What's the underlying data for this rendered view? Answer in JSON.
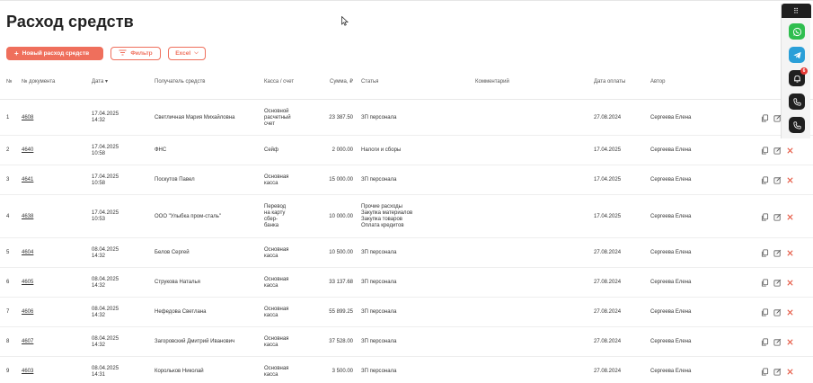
{
  "page": {
    "title": "Расход средств"
  },
  "toolbar": {
    "new_label": "Новый расход средств",
    "filter_label": "Фильтр",
    "excel_label": "Excel"
  },
  "table": {
    "columns": {
      "num": "№",
      "doc": "№ документа",
      "date": "Дата",
      "recipient": "Получатель средств",
      "kassa": "Касса / счет",
      "sum": "Сумма, ₽",
      "article": "Статья",
      "comment": "Комментарий",
      "paydate": "Дата оплаты",
      "author": "Автор"
    },
    "rows": [
      {
        "num": "1",
        "doc": "4608",
        "date": "17.04.2025",
        "time": "14:32",
        "recipient": "Светличная Мария Михайловна",
        "kassa": [
          "Основной",
          "расчетный",
          "счет"
        ],
        "sum": "23 387.50",
        "article": [
          "ЗП персонала"
        ],
        "comment": "",
        "paydate": "27.08.2024",
        "author": "Сергеева Елена"
      },
      {
        "num": "2",
        "doc": "4640",
        "date": "17.04.2025",
        "time": "10:58",
        "recipient": "ФНС",
        "kassa": [
          "Сейф"
        ],
        "sum": "2 000.00",
        "article": [
          "Налоги и сборы"
        ],
        "comment": "",
        "paydate": "17.04.2025",
        "author": "Сергеева Елена"
      },
      {
        "num": "3",
        "doc": "4641",
        "date": "17.04.2025",
        "time": "10:58",
        "recipient": "Поскутов Павел",
        "kassa": [
          "Основная",
          "касса"
        ],
        "sum": "15 000.00",
        "article": [
          "ЗП персонала"
        ],
        "comment": "",
        "paydate": "17.04.2025",
        "author": "Сергеева Елена"
      },
      {
        "num": "4",
        "doc": "4638",
        "date": "17.04.2025",
        "time": "10:53",
        "recipient": "ООО \"Улыбка пром-сталь\"",
        "kassa": [
          "Перевод",
          "на карту",
          "сбер-",
          "банка"
        ],
        "sum": "10 000.00",
        "article": [
          "Прочие расходы",
          "Закупка материалов",
          "Закупка товаров",
          "Оплата кредитов"
        ],
        "comment": "",
        "paydate": "17.04.2025",
        "author": "Сергеева Елена"
      },
      {
        "num": "5",
        "doc": "4604",
        "date": "08.04.2025",
        "time": "14:32",
        "recipient": "Белов Сергей",
        "kassa": [
          "Основная",
          "касса"
        ],
        "sum": "10 500.00",
        "article": [
          "ЗП персонала"
        ],
        "comment": "",
        "paydate": "27.08.2024",
        "author": "Сергеева Елена"
      },
      {
        "num": "6",
        "doc": "4605",
        "date": "08.04.2025",
        "time": "14:32",
        "recipient": "Струкова Наталья",
        "kassa": [
          "Основная",
          "касса"
        ],
        "sum": "33 137.68",
        "article": [
          "ЗП персонала"
        ],
        "comment": "",
        "paydate": "27.08.2024",
        "author": "Сергеева Елена"
      },
      {
        "num": "7",
        "doc": "4606",
        "date": "08.04.2025",
        "time": "14:32",
        "recipient": "Нефедова Светлана",
        "kassa": [
          "Основная",
          "касса"
        ],
        "sum": "55 899.25",
        "article": [
          "ЗП персонала"
        ],
        "comment": "",
        "paydate": "27.08.2024",
        "author": "Сергеева Елена"
      },
      {
        "num": "8",
        "doc": "4607",
        "date": "08.04.2025",
        "time": "14:32",
        "recipient": "Загоровский Дмитрий Иванович",
        "kassa": [
          "Основная",
          "касса"
        ],
        "sum": "37 528.00",
        "article": [
          "ЗП персонала"
        ],
        "comment": "",
        "paydate": "27.08.2024",
        "author": "Сергеева Елена"
      },
      {
        "num": "9",
        "doc": "4603",
        "date": "08.04.2025",
        "time": "14:31",
        "recipient": "Корольков Николай",
        "kassa": [
          "Основная",
          "касса"
        ],
        "sum": "3 500.00",
        "article": [
          "ЗП персонала"
        ],
        "comment": "",
        "paydate": "27.08.2024",
        "author": "Сергеева Елена"
      }
    ]
  },
  "side_panel": {
    "badge_count": "6",
    "buttons": [
      "whatsapp-icon",
      "telegram-icon",
      "bell-icon",
      "phone-icon",
      "phone-icon"
    ]
  },
  "colors": {
    "accent": "#ef6f5c",
    "whatsapp": "#2fbe4f",
    "telegram": "#2a9fd8",
    "dark": "#1f1f1f",
    "delete": "#e5533d"
  }
}
